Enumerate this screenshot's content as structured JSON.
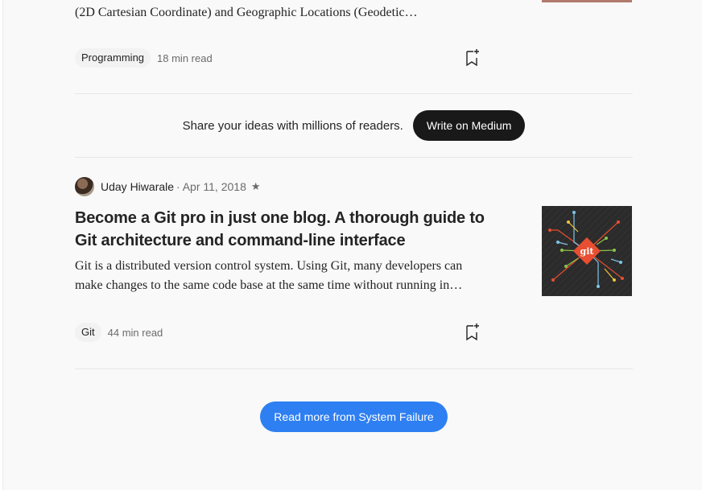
{
  "article_prev": {
    "excerpt": "(2D Cartesian Coordinate) and Geographic Locations (Geodetic…",
    "tag": "Programming",
    "read_time": "18 min read"
  },
  "promo": {
    "text": "Share your ideas with millions of readers.",
    "button_label": "Write on Medium"
  },
  "article": {
    "author": "Uday Hiwarale",
    "separator": "·",
    "date": "Apr 11, 2018",
    "member_icon": "★",
    "title": "Become a Git pro in just one blog. A thorough guide to Git architecture and command-line interface",
    "excerpt_line1": "Git is a distributed version control system. Using Git, many developers can",
    "excerpt_line2": "make changes to the same code base at the same time without running in…",
    "tag": "Git",
    "read_time": "44 min read",
    "thumbnail_text": "git"
  },
  "footer": {
    "read_more_label": "Read more from System Failure"
  },
  "colors": {
    "accent_blue": "#2e7ff1",
    "dark_button": "#191919",
    "git_orange": "#e84e31"
  }
}
